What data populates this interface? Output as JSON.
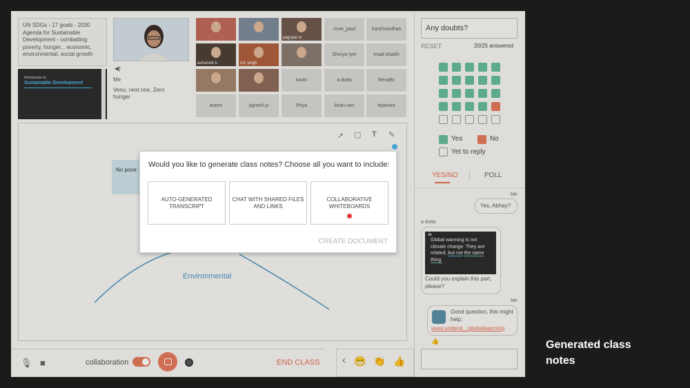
{
  "agenda": {
    "text": "UN SDGs - 17 goals - 2030 Agenda for Sustainable Development - combatting poverty, hunger... economic, environmental, social growth"
  },
  "slide": {
    "small": "Introduction to",
    "title": "Sustainable Development"
  },
  "teacher": {
    "label": "Me",
    "caption": "Venu, next one, Zero hunger",
    "speaker_icon": "speaker-icon"
  },
  "participants": {
    "photo_names": [
      "",
      "",
      "jaigopal m",
      "ashutosh k",
      "m1 singh",
      "",
      "",
      ""
    ],
    "tiles": [
      "rosie_paul",
      "harshvardhan",
      "Shreya Iyer",
      "Imad shaikh",
      "kavin",
      "a dutta",
      "Revathi",
      "asees",
      "jignesh.p",
      "Priya",
      "kiran ravi",
      "tejasvini"
    ]
  },
  "board": {
    "sticky_text": "No pove",
    "branch_label": "Environmental"
  },
  "modal": {
    "question": "Would you like to generate class notes? Choose all you want to include:",
    "options": [
      "AUTO-GENERATED TRANSCRIPT",
      "CHAT WITH SHARED FILES AND LINKS",
      "COLLABORATIVE WHITEBOARDS"
    ],
    "create_label": "CREATE DOCUMENT"
  },
  "bottom": {
    "collab_label": "collaboration",
    "end_label": "END CLASS"
  },
  "doubts": {
    "placeholder": "Any doubts?",
    "reset": "RESET",
    "answered": "20/25 answered"
  },
  "poll": {
    "yes_count": 19,
    "no_count": 1,
    "pending_count": 5,
    "legend_yes": "Yes",
    "legend_no": "No",
    "legend_pending": "Yet to reply",
    "tab_yesno": "YES/NO",
    "tab_poll": "POLL",
    "colors": {
      "yes": "#67bc9a",
      "no": "#e4795c"
    }
  },
  "chat": {
    "me1_label": "Me",
    "me1_text": "Yes, Abhay?",
    "dutta_label": "a dutta",
    "quote_line1": "Global warming is not climate change. They are related,",
    "quote_u": "but not",
    "quote_g": "the same thing.",
    "dutta_text": "Could you explain this part, please?",
    "me2_label": "Me",
    "me2_text": "Good question, this might help:",
    "me2_link": "www.underst.../globalwarming",
    "thumb": "👍"
  },
  "reactions": {
    "back": "‹",
    "laugh": "😁",
    "clap": "👏",
    "thumbs": "👍"
  },
  "caption": {
    "line1": "Generated class",
    "line2": "notes"
  }
}
